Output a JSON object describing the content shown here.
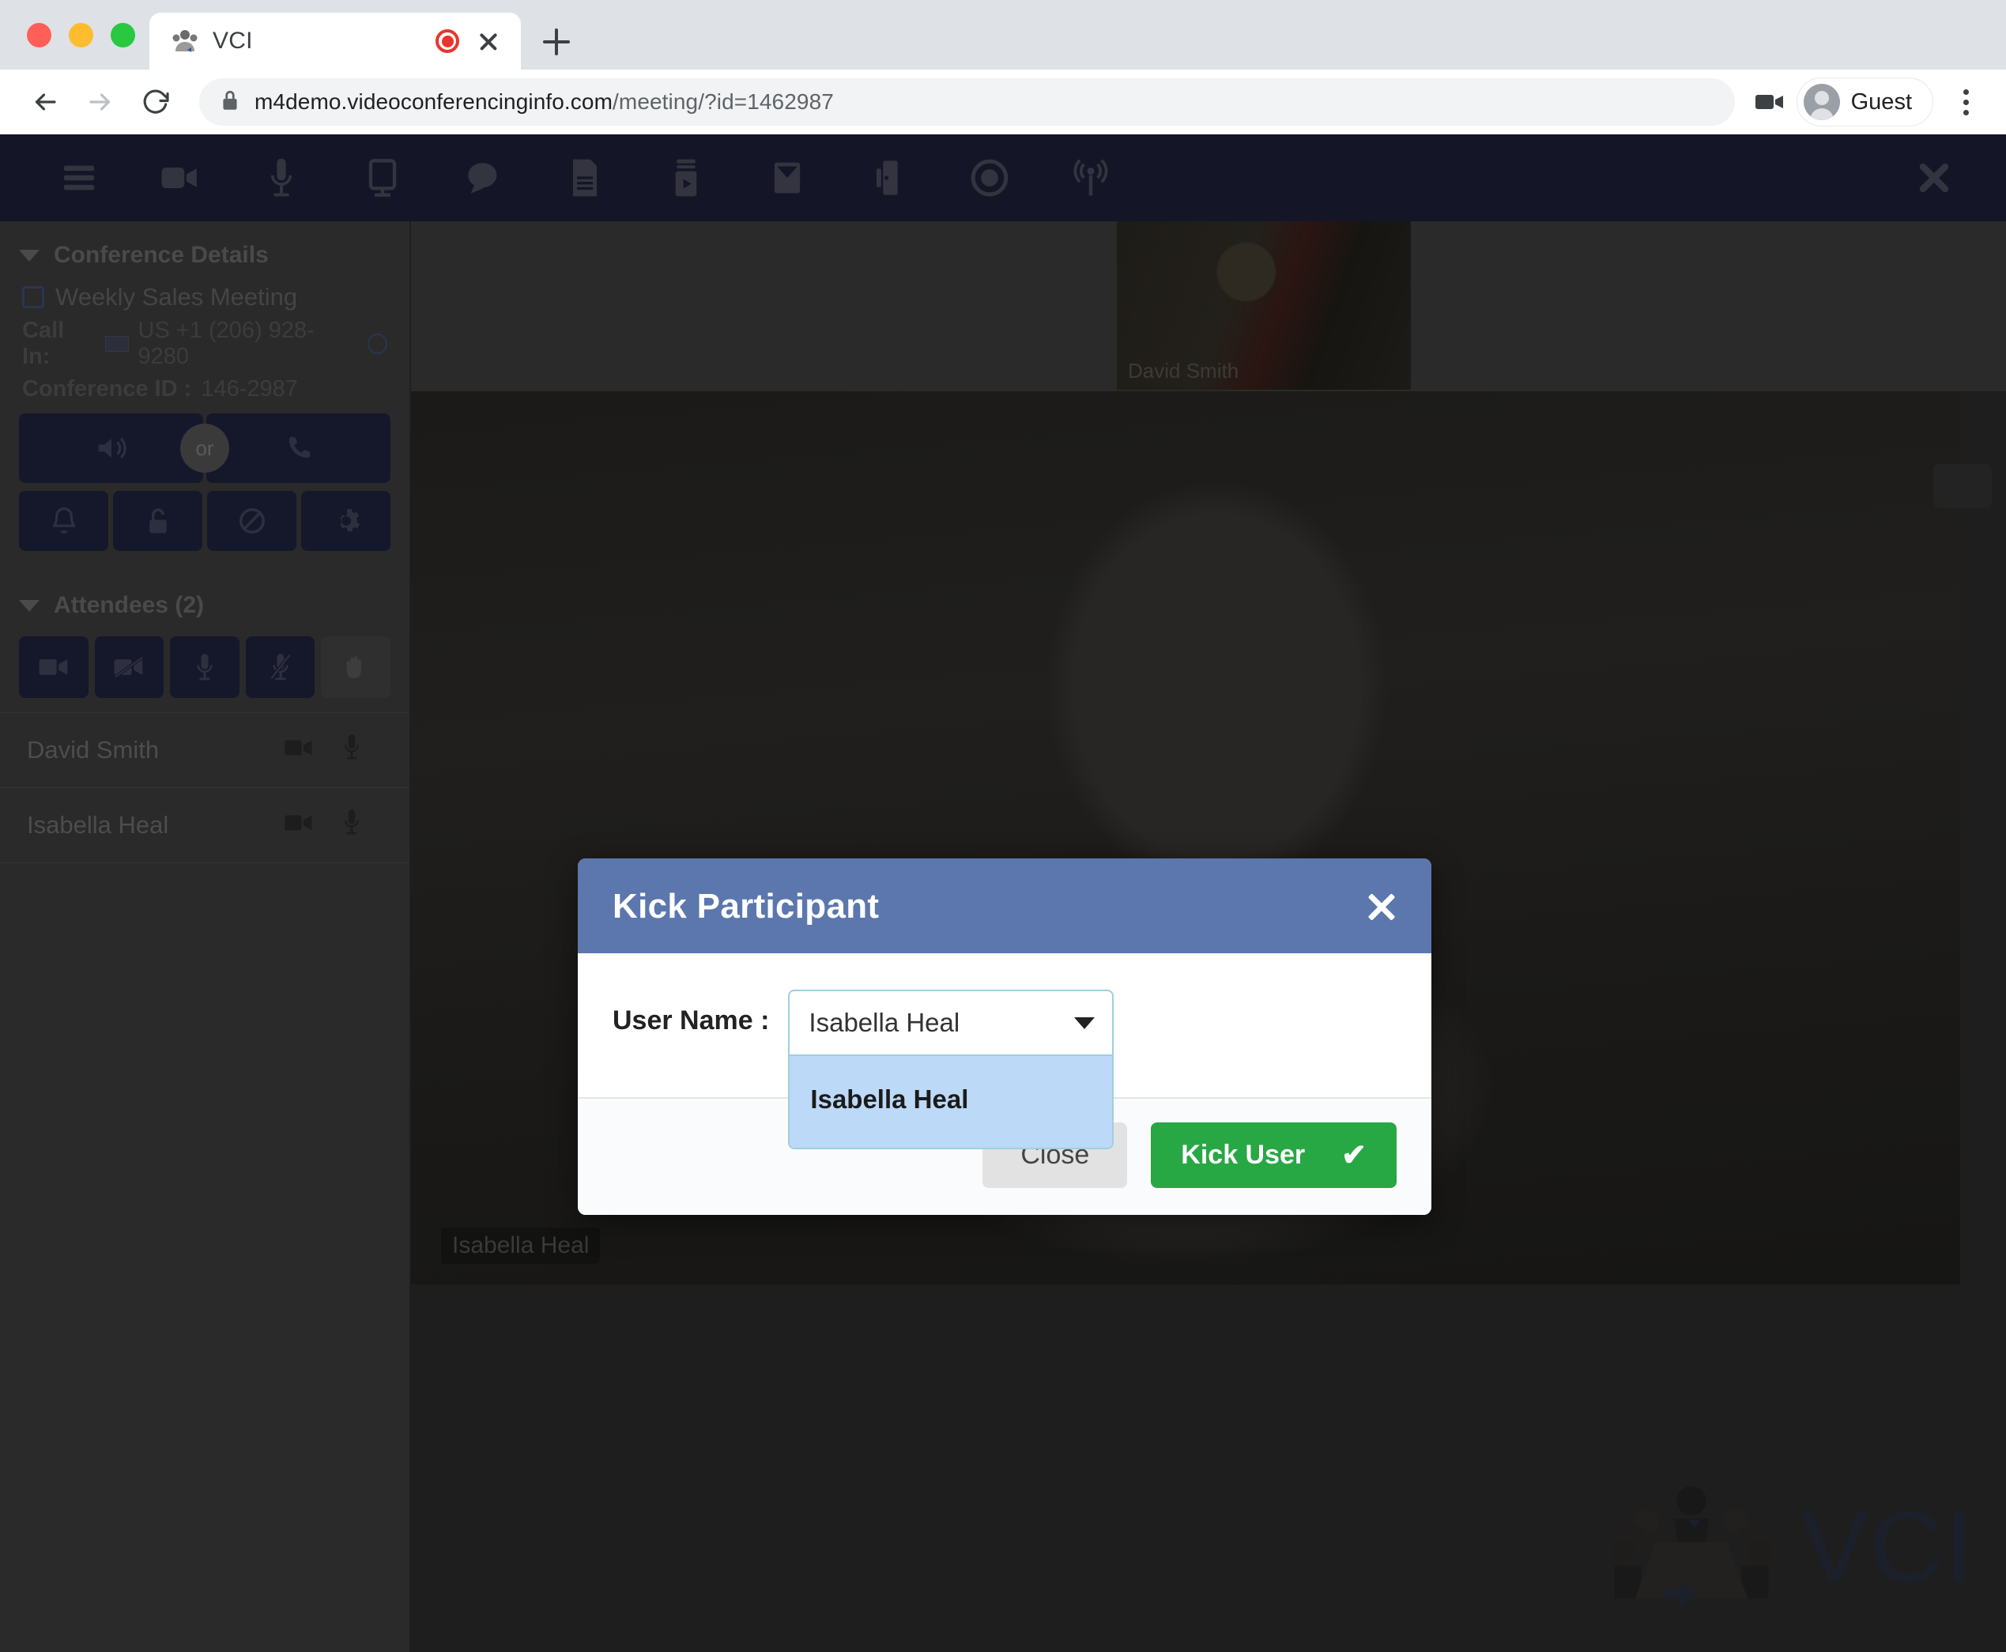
{
  "browser": {
    "tab": {
      "title": "VCI",
      "favicon": "conference-favicon",
      "recording_indicator": "recording-dot",
      "close": "close-icon"
    },
    "new_tab_label": "+",
    "nav": {
      "back": "back-arrow-icon",
      "forward": "forward-arrow-icon",
      "reload": "reload-icon"
    },
    "url": {
      "secure_icon": "lock-icon",
      "bold": "m4demo.videoconferencinginfo.com",
      "dim": "/meeting/?id=1462987"
    },
    "camera_icon": "camera-icon",
    "profile": {
      "name": "Guest",
      "avatar": "person-avatar-icon"
    },
    "menu_icon": "three-dot-menu-icon"
  },
  "app": {
    "toolbar": {
      "icons": [
        "hamburger-menu-icon",
        "video-camera-icon",
        "microphone-icon",
        "screen-share-icon",
        "chat-bubble-icon",
        "document-icon",
        "media-player-icon",
        "email-icon",
        "whiteboard-icon",
        "record-icon",
        "broadcast-icon"
      ],
      "close_icon": "close-icon"
    },
    "sidebar": {
      "conference": {
        "header": "Conference Details",
        "meeting_name": "Weekly Sales Meeting",
        "edit_icon": "edit-icon",
        "call_in_label": "Call In:",
        "call_in_number": "US +1 (206) 928-9280",
        "flag_icon": "us-flag-icon",
        "globe_icon": "globe-icon",
        "conference_id_label": "Conference ID :",
        "conference_id": "146-2987",
        "audio_buttons": {
          "speaker_icon": "speaker-icon",
          "or_label": "or",
          "phone_icon": "phone-icon"
        },
        "small_buttons": [
          "bell-icon",
          "unlock-icon",
          "block-icon",
          "gear-icon"
        ]
      },
      "attendees": {
        "header": "Attendees (2)",
        "controls": [
          "camera-on-icon",
          "camera-off-icon",
          "mic-on-icon",
          "mic-off-icon",
          "raise-hand-icon"
        ],
        "rows": [
          {
            "name": "David Smith",
            "camera_icon": "camera-icon",
            "mic_icon": "mic-icon"
          },
          {
            "name": "Isabella Heal",
            "camera_icon": "camera-icon",
            "mic_icon": "mic-icon"
          }
        ]
      }
    },
    "stage": {
      "thumbnail": {
        "label": "David Smith"
      },
      "main_video": {
        "label": "Isabella Heal"
      },
      "side_button": "expand-button",
      "watermark": {
        "text": "VCI",
        "icon": "conference-table-icon"
      }
    }
  },
  "modal": {
    "title": "Kick Participant",
    "close_icon": "close-icon",
    "field_label": "User Name :",
    "select": {
      "value": "Isabella Heal",
      "chevron_icon": "chevron-down-icon",
      "options": [
        "Isabella Heal"
      ]
    },
    "buttons": {
      "close": "Close",
      "kick": "Kick User",
      "kick_check_icon": "check-icon"
    }
  },
  "colors": {
    "modal_header": "#5b77ad",
    "kick_button": "#28a745",
    "dropdown_highlight": "#bcd9f7",
    "select_border": "#9dd0dd",
    "app_toolbar": "#141627",
    "sidebar": "#2a2a2a"
  }
}
